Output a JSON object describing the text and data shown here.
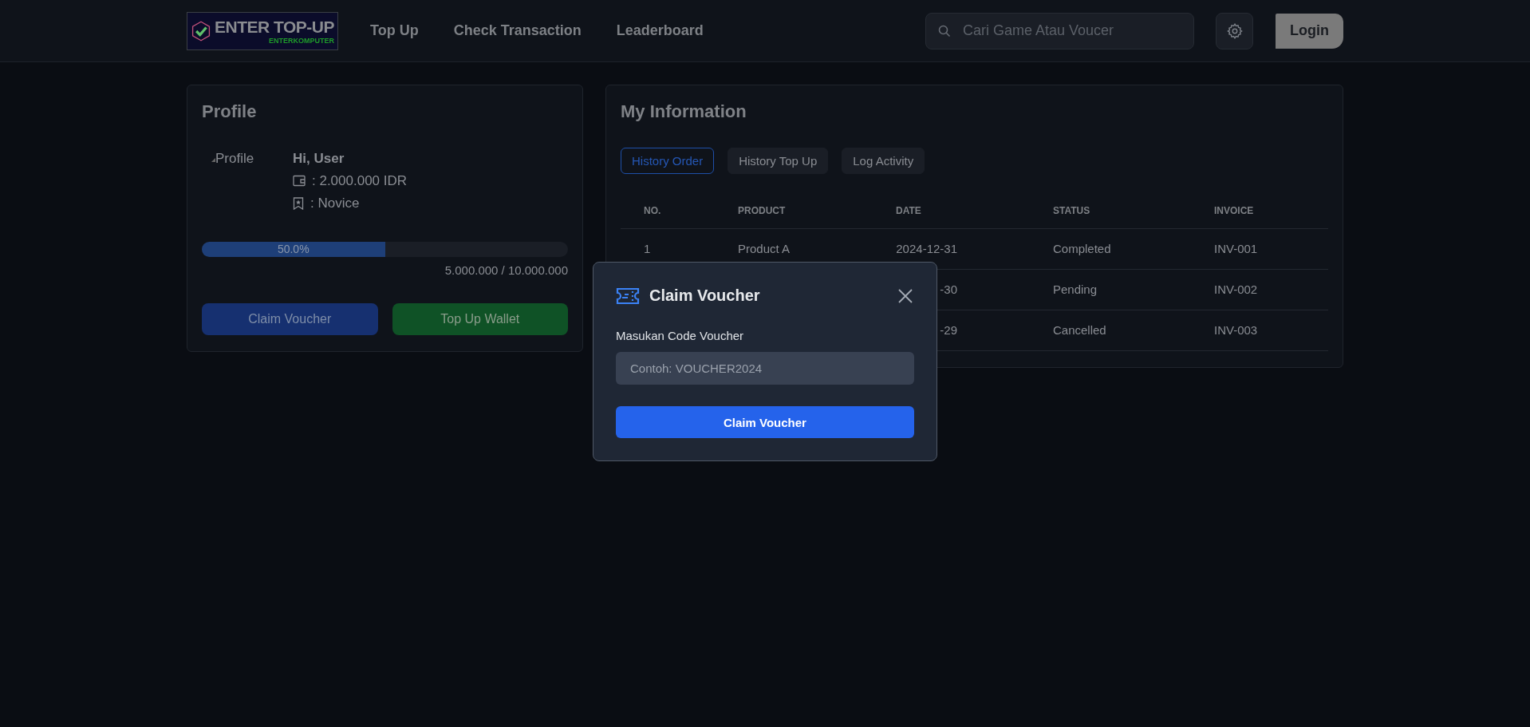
{
  "header": {
    "logo": {
      "title": "ENTER TOP-UP",
      "subtitle": "ENTERKOMPUTER"
    },
    "nav": [
      {
        "label": "Top Up"
      },
      {
        "label": "Check Transaction"
      },
      {
        "label": "Leaderboard"
      }
    ],
    "search": {
      "placeholder": "Cari Game Atau Voucer"
    },
    "login_button": "Login"
  },
  "profile": {
    "title": "Profile",
    "avatar_alt": "Profile",
    "greeting": "Hi, User",
    "balance": ": 2.000.000 IDR",
    "rank": ": Novice",
    "progress": {
      "level": 0.5,
      "label": "50.0%",
      "reading": "5.000.000 / 10.000.000"
    },
    "buttons": [
      {
        "label": "Claim Voucher",
        "kind": "voucher"
      },
      {
        "label": "Top Up Wallet",
        "kind": "wallet"
      }
    ]
  },
  "information": {
    "title": "My Information",
    "tabs": [
      {
        "label": "History Order",
        "selected": true
      },
      {
        "label": "History Top Up",
        "selected": false
      },
      {
        "label": "Log Activity",
        "selected": false
      }
    ],
    "table": {
      "columns": [
        "NO.",
        "PRODUCT",
        "DATE",
        "STATUS",
        "INVOICE"
      ],
      "rows": [
        {
          "no": "1",
          "product": "Product A",
          "date": "2024-12-31",
          "status": "Completed",
          "invoice": "INV-001"
        },
        {
          "date": "-30",
          "status": "Pending",
          "invoice": "INV-002"
        },
        {
          "date": "-29",
          "status": "Cancelled",
          "invoice": "INV-003"
        }
      ]
    }
  },
  "modal": {
    "title": "Claim Voucher",
    "field_label": "Masukan Code Voucher",
    "placeholder": "Contoh: VOUCHER2024",
    "button": "Claim Voucher"
  }
}
